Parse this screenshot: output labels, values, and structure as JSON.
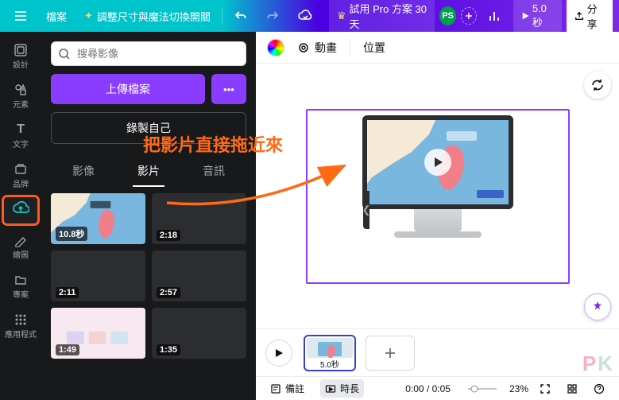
{
  "top": {
    "file": "檔案",
    "resize": "調整尺寸與魔法切換開關",
    "pro": "試用 Pro 方案 30 天",
    "avatar": "PS",
    "play_time": "5.0秒",
    "share": "分享"
  },
  "rail": {
    "design": "設計",
    "elements": "元素",
    "text": "文字",
    "brand": "品牌",
    "uploads": "",
    "draw": "繪圖",
    "projects": "專案",
    "apps": "應用程式"
  },
  "panel": {
    "search_placeholder": "搜尋影像",
    "upload": "上傳檔案",
    "record": "錄製自己",
    "tab_image": "影像",
    "tab_video": "影片",
    "tab_audio": "音訊",
    "thumbs": [
      {
        "dur": "10.8秒"
      },
      {
        "dur": "2:18"
      },
      {
        "dur": "2:11"
      },
      {
        "dur": "2:57"
      },
      {
        "dur": "1:49"
      },
      {
        "dur": "1:35"
      }
    ]
  },
  "secbar": {
    "anim": "動畫",
    "pos": "位置"
  },
  "annotation": "把影片直接拖近來",
  "timeline": {
    "frame_label": "5.0秒"
  },
  "status": {
    "notes": "備註",
    "duration": "時長",
    "time": "0:00 / 0:05",
    "zoom": "23%"
  }
}
